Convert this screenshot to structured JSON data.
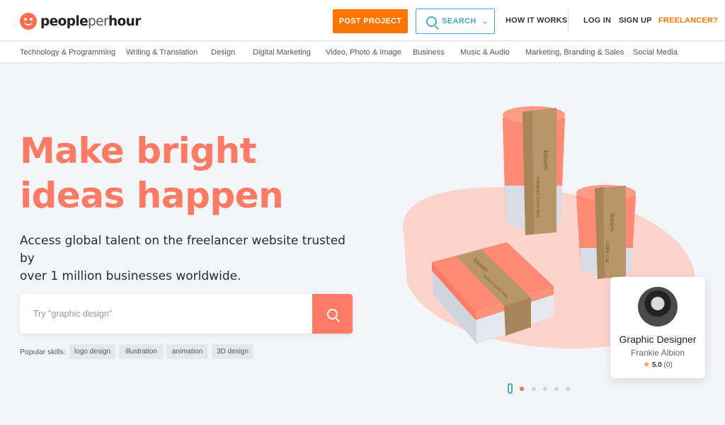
{
  "brand": {
    "name_part1": "people",
    "name_part2": "per",
    "name_part3": "hour",
    "accent": "#ff6e4a",
    "cta": "#ff7500",
    "link": "#4aa7cf"
  },
  "header": {
    "post_project": "POST PROJECT",
    "search": "SEARCH",
    "how_it_works": "HOW IT WORKS",
    "log_in": "LOG IN",
    "sign_up": "SIGN UP",
    "freelancer": "FREELANCER?"
  },
  "categories": [
    "Technology & Programming",
    "Writing & Translation",
    "Design",
    "Digital Marketing",
    "Video, Photo & Image",
    "Business",
    "Music & Audio",
    "Marketing, Branding & Sales",
    "Social Media"
  ],
  "hero": {
    "title_line1": "Make bright",
    "title_line2": "ideas happen",
    "subtitle_line1": "Access global talent on the freelancer website trusted by",
    "subtitle_line2": "over 1 million businesses worldwide.",
    "search_placeholder": "Try \"graphic design\"",
    "popular_label": "Popular skills:",
    "skills": [
      "logo design",
      "illustration",
      "animation",
      "3D design"
    ]
  },
  "illustration": {
    "box_label": "bloom",
    "cup_label": "compact lunch box",
    "small_cup_label": "cubby cup",
    "box_front_label": "bloom lunch box"
  },
  "profile_card": {
    "title": "Graphic Designer",
    "name": "Frankie Albion",
    "rating": "5.0",
    "reviews": "(0)"
  },
  "carousel": {
    "slides": 5,
    "active": 0
  }
}
